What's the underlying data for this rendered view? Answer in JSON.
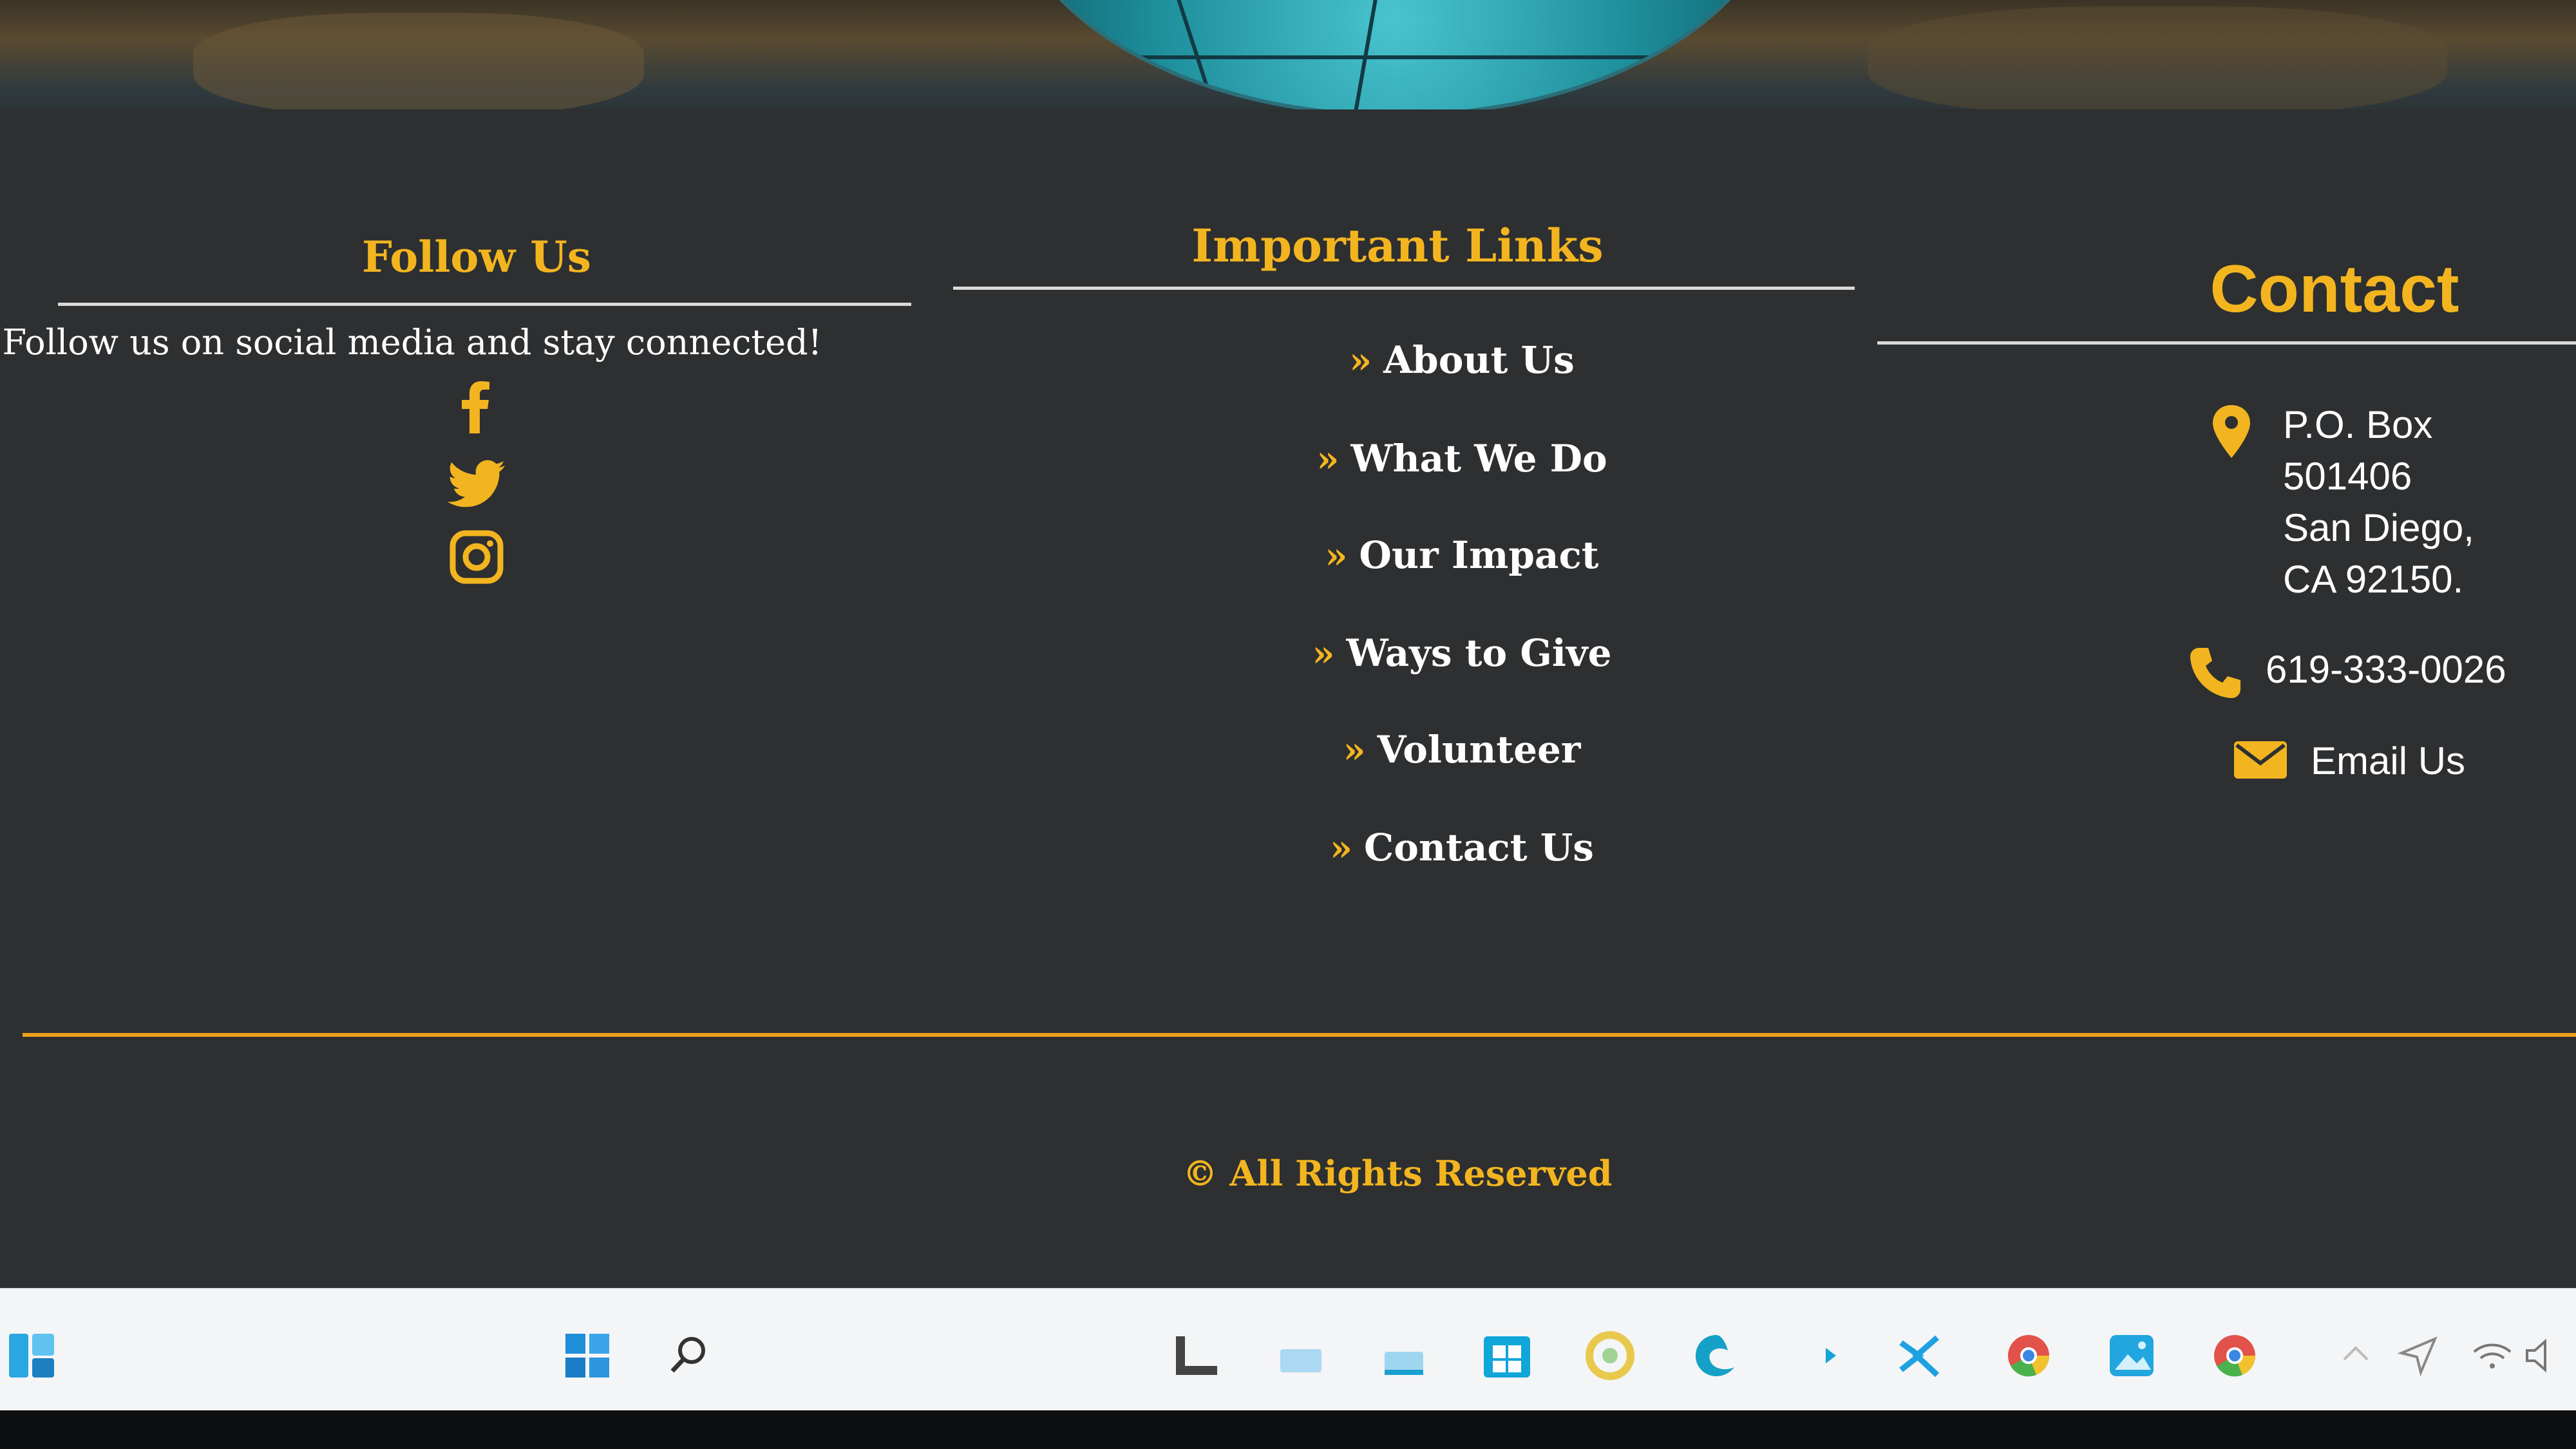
{
  "follow": {
    "title": "Follow Us",
    "text": "Follow us on social media and stay connected!",
    "icons": [
      "facebook-icon",
      "twitter-icon",
      "instagram-icon"
    ]
  },
  "links": {
    "title": "Important Links",
    "arrow": "»",
    "items": [
      "About Us",
      "What We Do",
      "Our Impact",
      "Ways to Give",
      "Volunteer",
      "Contact Us"
    ]
  },
  "contact": {
    "title": "Contact",
    "address_lines": [
      "P.O. Box",
      "501406",
      "San Diego,",
      "CA 92150."
    ],
    "phone": "619-333-0026",
    "email_label": "Email Us"
  },
  "footer": {
    "copyright": "© All Rights Reserved"
  },
  "colors": {
    "accent": "#f3b51f",
    "background": "#2d2f31",
    "text": "#ffffff"
  },
  "taskbar": {
    "icons": [
      "widgets-icon",
      "start-icon",
      "search-icon",
      "task-view-icon",
      "file-explorer-icon",
      "folder-icon",
      "store-icon",
      "chrome-canary-icon",
      "edge-icon",
      "terminal-icon",
      "vscode-icon",
      "chrome-icon",
      "photos-icon",
      "chrome-dev-icon",
      "tray-chevron-icon",
      "location-icon",
      "wifi-icon",
      "volume-icon"
    ]
  }
}
